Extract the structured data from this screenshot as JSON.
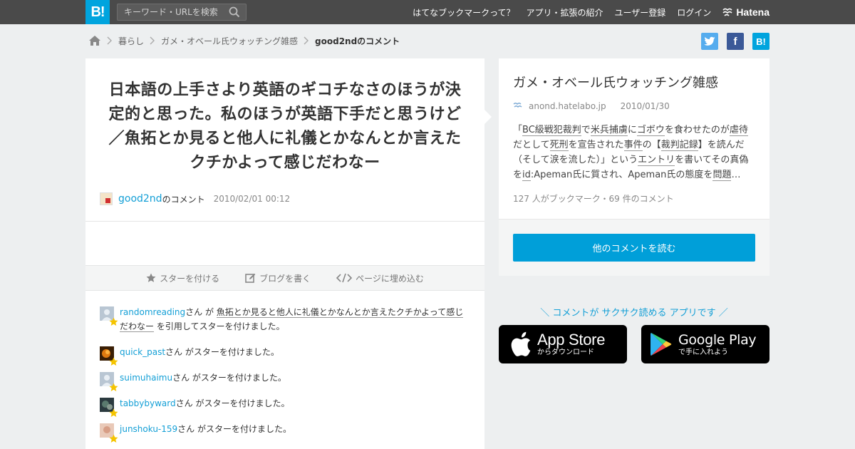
{
  "header": {
    "logo": "B!",
    "search_placeholder": "キーワード・URLを検索",
    "nav": [
      "はてなブックマークって？",
      "アプリ・拡張の紹介",
      "ユーザー登録",
      "ログイン"
    ],
    "brand": "Hatena"
  },
  "breadcrumb": {
    "items": [
      "暮らし",
      "ガメ・オベール氏ウォッチング雑感",
      "good2ndのコメント"
    ]
  },
  "share": {
    "twitter": "",
    "facebook": "f",
    "hatena": "B!"
  },
  "comment": {
    "text": "日本語の上手さより英語のギコチなさのほうが決定的と思った。私のほうが英語下手だと思うけど／魚拓とか見ると他人に礼儀とかなんとか言えたクチかよって感じだわなー",
    "user": "good2nd",
    "user_suffix": "のコメント",
    "date": "2010/02/01 00:12"
  },
  "actions": {
    "star": "スターを付ける",
    "blog": "ブログを書く",
    "embed": "ページに埋め込む"
  },
  "stars": [
    {
      "user": "randomreading",
      "mid": "さん が ",
      "quote": "魚拓とか見ると他人に礼儀とかなんとか言えたクチかよって感じだわなー",
      "tail": " を引用してスターを付けました。"
    },
    {
      "user": "quick_past",
      "mid": "さん がスターを付けました。"
    },
    {
      "user": "suimuhaimu",
      "mid": "さん がスターを付けました。"
    },
    {
      "user": "tabbybyward",
      "mid": "さん がスターを付けました。"
    },
    {
      "user": "junshoku-159",
      "mid": "さん がスターを付けました。"
    }
  ],
  "entry": {
    "title": "ガメ・オベール氏ウォッチング雑感",
    "domain": "anond.hatelabo.jp",
    "date": "2010/01/30",
    "desc_parts": [
      "「",
      "BC級戦犯裁判",
      "で",
      "米兵捕虜",
      "に",
      "ゴボウ",
      "を食わせたのが",
      "虐待",
      "だとして",
      "死刑",
      "を宣告された",
      "事件",
      "の【",
      "裁判記録",
      "】を読んだ（そして涙を流した）」という",
      "エントリ",
      "を書いてその真偽を",
      "id",
      ":Apeman氏に質され、Apeman氏の態度を",
      "問題",
      "…"
    ],
    "count": "127 人がブックマーク・69 件のコメント",
    "button": "他のコメントを読む"
  },
  "promo": {
    "text": "＼ コメントが サクサク読める アプリです ／",
    "appstore_main": "App Store",
    "appstore_sub": "からダウンロード",
    "googleplay_main": "Google Play",
    "googleplay_sub": "で手に入れよう"
  },
  "colors": {
    "accent": "#00a4de",
    "link": "#139fd6",
    "topbar": "#4a4a4a",
    "button": "#009fd9"
  }
}
